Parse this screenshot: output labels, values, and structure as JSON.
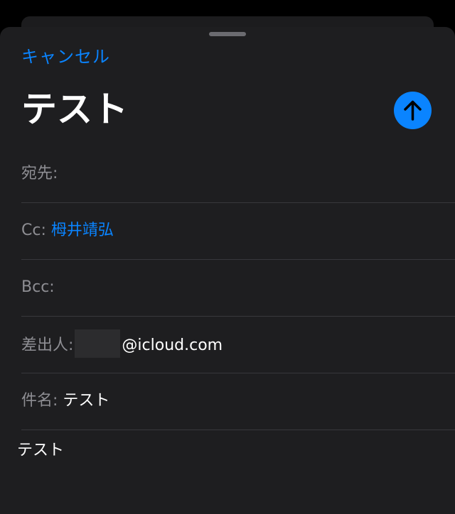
{
  "compose": {
    "cancel_label": "キャンセル",
    "title": "テスト",
    "send_icon": "arrow-up-icon",
    "fields": {
      "to": {
        "label": "宛先:",
        "value": ""
      },
      "cc": {
        "label": "Cc:",
        "value": "栂井靖弘"
      },
      "bcc": {
        "label": "Bcc:",
        "value": ""
      },
      "from": {
        "label": "差出人:",
        "value": "@icloud.com"
      },
      "subject": {
        "label": "件名:",
        "value": "テスト"
      }
    },
    "body": "テスト"
  },
  "colors": {
    "accent": "#0a84ff",
    "sheet_background": "#1e1e20",
    "label": "#8e8e93",
    "separator": "#38383c"
  }
}
